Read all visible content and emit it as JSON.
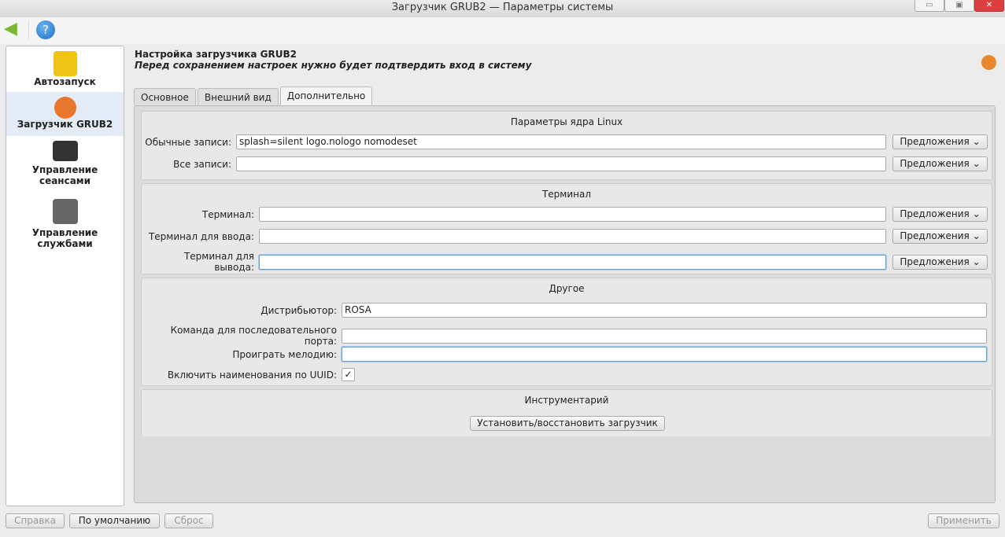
{
  "window": {
    "title": "Загрузчик GRUB2 — Параметры системы"
  },
  "sidebar": {
    "items": [
      {
        "label": "Автозапуск"
      },
      {
        "label": "Загрузчик GRUB2"
      },
      {
        "label": "Управление сеансами"
      },
      {
        "label": "Управление службами"
      }
    ]
  },
  "header": {
    "title": "Настройка загрузчика GRUB2",
    "subtitle": "Перед сохранением настроек нужно будет подтвердить вход в систему"
  },
  "tabs": [
    "Основное",
    "Внешний вид",
    "Дополнительно"
  ],
  "kernel": {
    "title": "Параметры ядра Linux",
    "normal_label": "Обычные записи:",
    "normal_value": "splash=silent logo.nologo nomodeset",
    "all_label": "Все записи:",
    "all_value": ""
  },
  "terminal": {
    "title": "Терминал",
    "term_label": "Терминал:",
    "input_label": "Терминал для ввода:",
    "output_label": "Терминал для вывода:"
  },
  "suggest": "Предложения ⌄",
  "other": {
    "title": "Другое",
    "distributor_label": "Дистрибьютор:",
    "distributor_value": "ROSA",
    "serial_label": "Команда для последовательного порта:",
    "tune_label": "Проиграть мелодию:",
    "uuid_label": "Включить наименования по UUID:",
    "uuid_checked": true,
    "check": "✓"
  },
  "tools": {
    "title": "Инструментарий",
    "install": "Установить/восстановить загрузчик"
  },
  "footer": {
    "help": "Справка",
    "defaults": "По умолчанию",
    "reset": "Сброс",
    "apply": "Применить"
  }
}
